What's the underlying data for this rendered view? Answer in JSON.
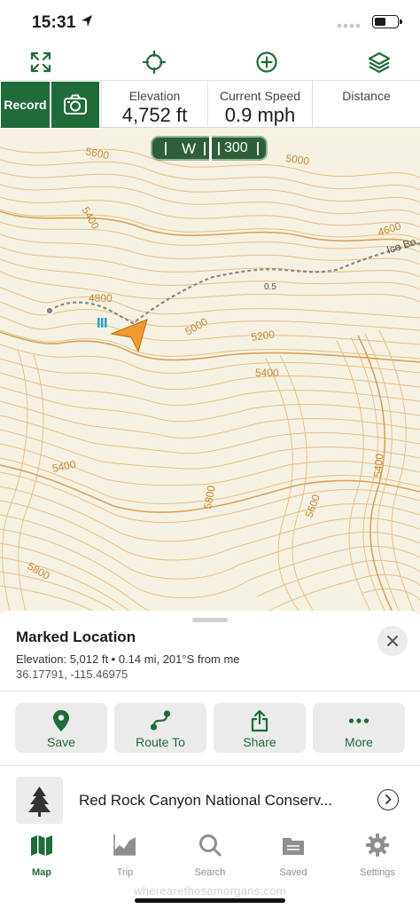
{
  "status": {
    "time": "15:31",
    "icons": [
      "location-arrow-icon",
      "signal-dots-icon",
      "battery-icon"
    ]
  },
  "toolbar": {
    "icons": [
      "fullscreen-icon",
      "crosshair-icon",
      "add-circle-icon",
      "layers-icon"
    ]
  },
  "stats": {
    "record_label": "Record",
    "camera_icon": "camera-icon",
    "elevation": {
      "label": "Elevation",
      "value": "4,752 ft"
    },
    "speed": {
      "label": "Current Speed",
      "value": "0.9 mph"
    },
    "distance": {
      "label": "Distance",
      "value": ""
    }
  },
  "compass": {
    "direction": "W",
    "degrees": "300"
  },
  "map": {
    "contour_labels": [
      "5600",
      "5000",
      "5400",
      "4600",
      "4800",
      "0.5",
      "5000",
      "5200",
      "5400",
      "5400",
      "5800",
      "5600",
      "5400",
      "5800"
    ],
    "trail_label": "Ice Bo",
    "colors": {
      "background": "#f6f2e3",
      "contour": "#e5b877",
      "contour_index": "#d79a4c",
      "marker": "#f29a2e",
      "trail": "#8a8a8a"
    }
  },
  "sheet": {
    "title": "Marked Location",
    "elevation_line": "Elevation: 5,012 ft • 0.14 mi, 201°S from me",
    "coords": "36.17791, -115.46975",
    "close_icon": "close-icon",
    "actions": [
      {
        "label": "Save",
        "icon": "pin-icon"
      },
      {
        "label": "Route To",
        "icon": "route-icon"
      },
      {
        "label": "Share",
        "icon": "share-icon"
      },
      {
        "label": "More",
        "icon": "more-dots-icon"
      }
    ],
    "place": {
      "name": "Red Rock Canyon National Conserv...",
      "icon": "tree-icon",
      "chevron": "chevron-right-circle-icon"
    }
  },
  "tabs": [
    {
      "label": "Map",
      "icon": "map-icon",
      "active": true
    },
    {
      "label": "Trip",
      "icon": "trip-chart-icon",
      "active": false
    },
    {
      "label": "Search",
      "icon": "search-icon",
      "active": false
    },
    {
      "label": "Saved",
      "icon": "saved-folder-icon",
      "active": false
    },
    {
      "label": "Settings",
      "icon": "gear-icon",
      "active": false
    }
  ],
  "watermark": "wherearethosemorgans.com",
  "theme": {
    "accent": "#1f6b3a",
    "gray": "#8e8e93"
  }
}
